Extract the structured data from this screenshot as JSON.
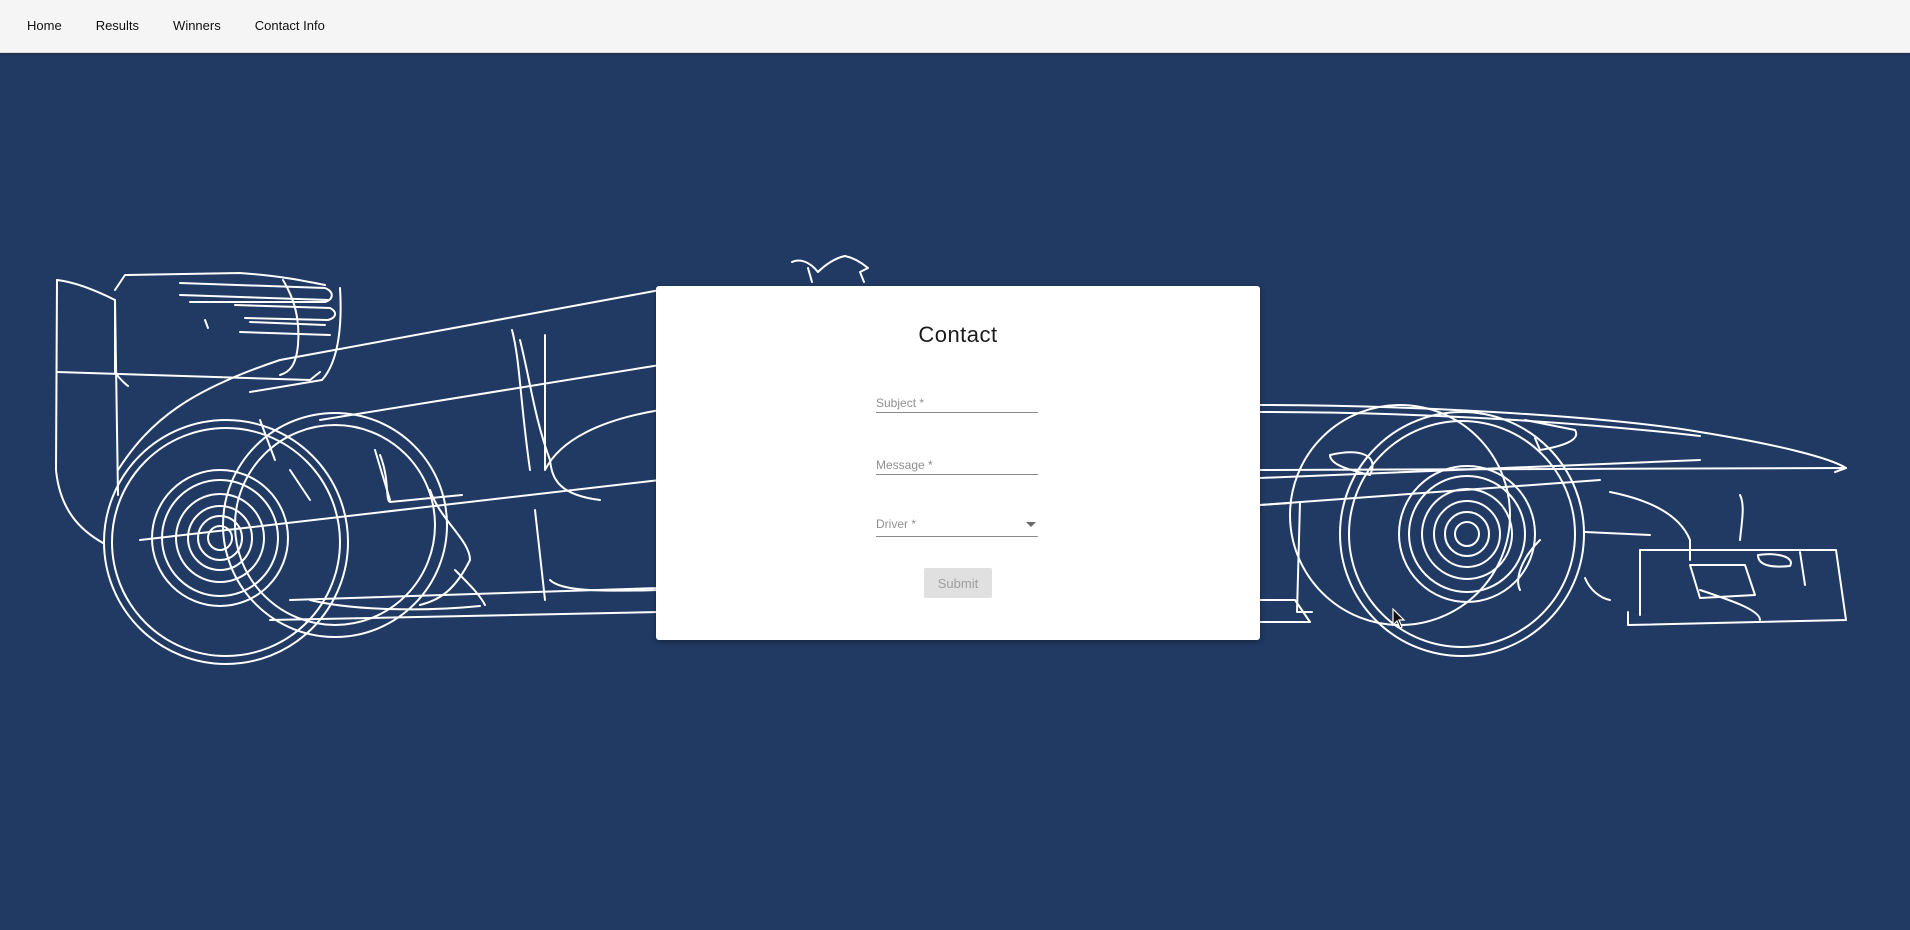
{
  "nav": {
    "items": [
      {
        "label": "Home"
      },
      {
        "label": "Results"
      },
      {
        "label": "Winners"
      },
      {
        "label": "Contact Info"
      }
    ]
  },
  "contact_form": {
    "title": "Contact",
    "subject": {
      "placeholder": "Subject *",
      "value": ""
    },
    "message": {
      "placeholder": "Message *",
      "value": ""
    },
    "driver": {
      "label": "Driver *"
    },
    "submit_label": "Submit"
  },
  "colors": {
    "background": "#213a63",
    "navbar": "#f5f5f5",
    "card": "#ffffff",
    "button_disabled": "#e0e0e0"
  },
  "icons": [
    "chevron-down-icon",
    "mouse-cursor-icon"
  ]
}
